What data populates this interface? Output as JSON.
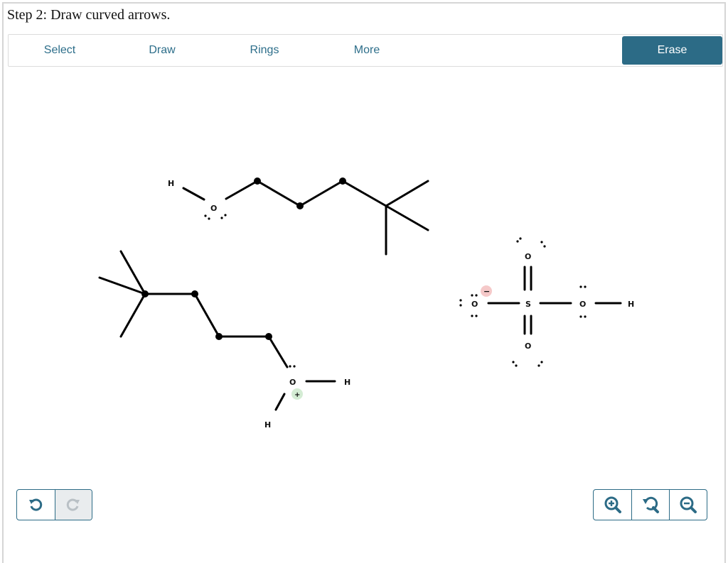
{
  "step_title": "Step 2: Draw curved arrows.",
  "toolbar": {
    "tabs": [
      {
        "label": "Select"
      },
      {
        "label": "Draw"
      },
      {
        "label": "Rings"
      },
      {
        "label": "More"
      }
    ],
    "erase_label": "Erase"
  },
  "atoms": {
    "H": "H",
    "O": "O",
    "S": "S",
    "plus": "+",
    "minus": "−"
  },
  "colors": {
    "accent": "#2c6b86",
    "tab_text": "#2d6e8a",
    "positive_charge": "#d4ecd4",
    "negative_charge": "#f5c9c9"
  },
  "controls": {
    "history": [
      "undo-icon",
      "redo-icon"
    ],
    "zoom": [
      "zoom-in-icon",
      "reset-zoom-icon",
      "zoom-out-icon"
    ]
  }
}
